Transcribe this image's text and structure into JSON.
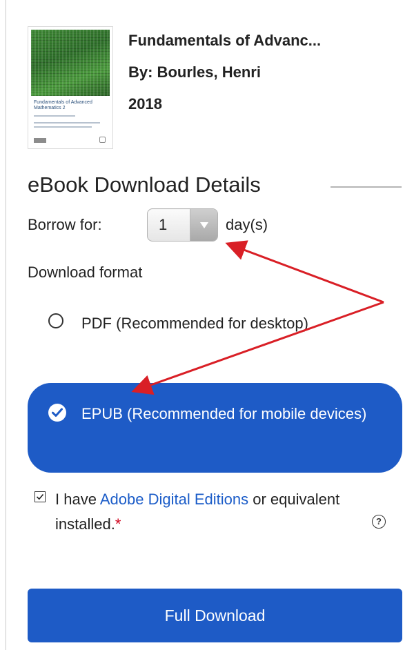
{
  "book": {
    "title": "Fundamentals of Advanc...",
    "author": "By: Bourles, Henri",
    "year": "2018",
    "cover_text": "Fundamentals of Advanced Mathematics 2"
  },
  "section": {
    "title": "eBook Download Details"
  },
  "borrow": {
    "label": "Borrow for:",
    "value": "1",
    "unit": "day(s)"
  },
  "format": {
    "label": "Download format",
    "options": [
      {
        "label": "PDF (Recommended for desktop)",
        "selected": false
      },
      {
        "label": "EPUB (Recommended for mobile devices)",
        "selected": true
      }
    ]
  },
  "agreement": {
    "prefix": "I have ",
    "link": "Adobe Digital Editions",
    "suffix": " or equivalent installed.",
    "required_mark": "*",
    "checked": true
  },
  "actions": {
    "download_label": "Full Download"
  },
  "colors": {
    "accent": "#1e5bc6",
    "link": "#1b5cc8",
    "required": "#d0021b",
    "annotation": "#d91f26"
  }
}
